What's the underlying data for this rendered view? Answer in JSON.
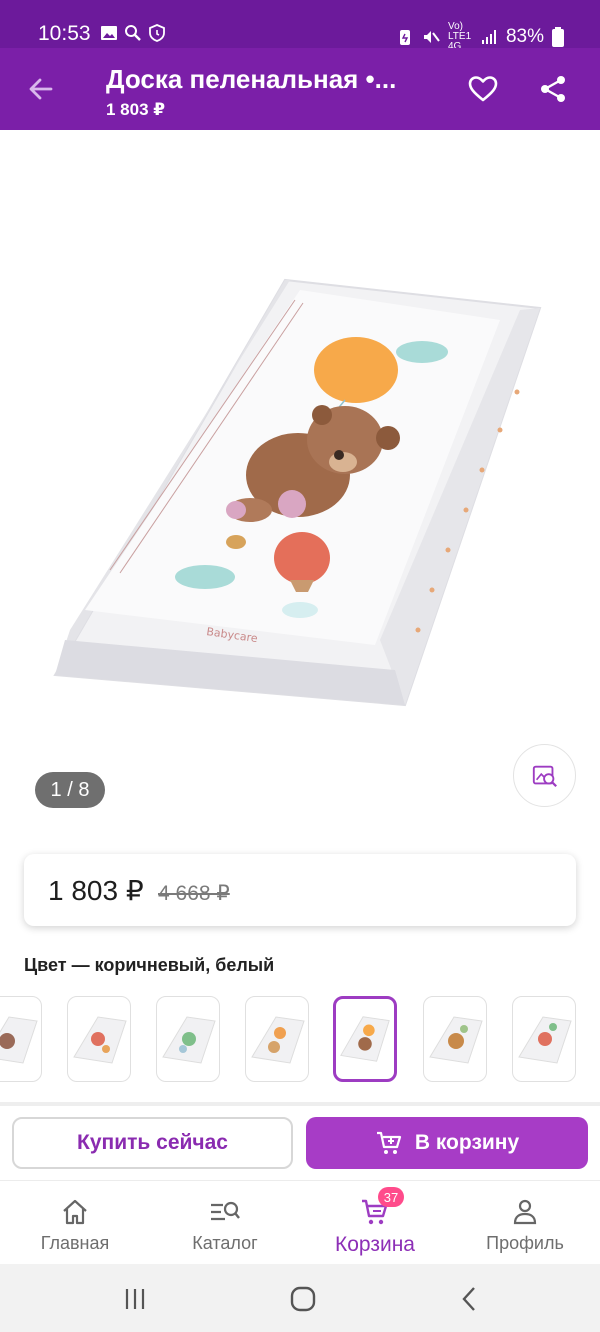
{
  "status_bar": {
    "time": "10:53",
    "network": "Vo) LTE1 4G",
    "battery": "83%"
  },
  "app_bar": {
    "title": "Доска пеленальная •...",
    "price": "1 803 ₽",
    "back_icon": "arrow-left-icon",
    "favorite_icon": "heart-outline-icon",
    "share_icon": "share-icon"
  },
  "gallery": {
    "counter": "1 / 8",
    "visual_search_icon": "image-search-icon"
  },
  "price_card": {
    "current": "1 803 ₽",
    "old": "4 668 ₽"
  },
  "color": {
    "label": "Цвет — коричневый, белый",
    "selected_index": 4,
    "options": [
      "variant-1",
      "variant-2",
      "variant-3",
      "variant-4",
      "variant-5",
      "variant-6",
      "variant-7"
    ]
  },
  "actions": {
    "buy_now": "Купить сейчас",
    "add_to_cart": "В корзину"
  },
  "bottom_nav": {
    "items": [
      {
        "label": "Главная",
        "icon": "home-icon"
      },
      {
        "label": "Каталог",
        "icon": "catalog-search-icon"
      },
      {
        "label": "Корзина",
        "icon": "cart-icon",
        "badge": "37"
      },
      {
        "label": "Профиль",
        "icon": "profile-icon"
      }
    ],
    "active": "Корзина"
  },
  "colors": {
    "primary": "#7b1fa8",
    "status_bar": "#6c1a9b",
    "accent": "#a73cc6",
    "badge": "#ff4b8b"
  }
}
